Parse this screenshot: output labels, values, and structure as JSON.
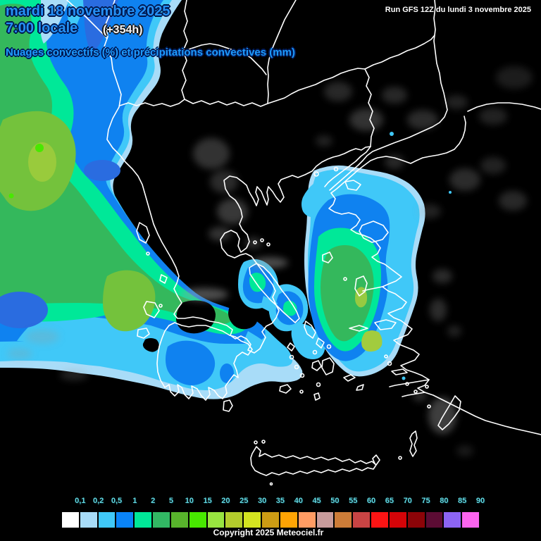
{
  "header": {
    "date_line1": "mardi 18 novembre 2025",
    "date_line2": "7:00 locale",
    "forecast_offset": "(+354h)",
    "run_info": "Run GFS 12Z du lundi 3 novembre 2025",
    "subtitle": "Nuages convectifs (%) et précipitations convectives (mm)"
  },
  "legend": {
    "labels": [
      "0,1",
      "0,2",
      "0,5",
      "1",
      "2",
      "5",
      "10",
      "15",
      "20",
      "25",
      "30",
      "35",
      "40",
      "45",
      "50",
      "55",
      "60",
      "65",
      "70",
      "75",
      "80",
      "85",
      "90"
    ],
    "colors": [
      "#ffffff",
      "#a8dcf8",
      "#40c8f8",
      "#0a84f8",
      "#00e898",
      "#32b864",
      "#58b42c",
      "#48e800",
      "#98e440",
      "#b4cc2c",
      "#d4e420",
      "#cc9c14",
      "#ffa404",
      "#ff9c64",
      "#c89c9c",
      "#cc7c38",
      "#c84444",
      "#fc1414",
      "#d40408",
      "#8c0408",
      "#5c0c34",
      "#8c64f4",
      "#fc64f0"
    ]
  },
  "map": {
    "background": "#000000",
    "coastline_color": "#ffffff",
    "cloud_gray": "#9a9a9a",
    "precip_lightblue": "#a8dcf8",
    "precip_cyan": "#40c8f8",
    "precip_blue": "#0f82f0",
    "precip_spring": "#00e898",
    "precip_green": "#34b85c",
    "precip_olive": "#74c23c"
  },
  "footer": {
    "copyright": "Copyright 2025 Meteociel.fr"
  }
}
